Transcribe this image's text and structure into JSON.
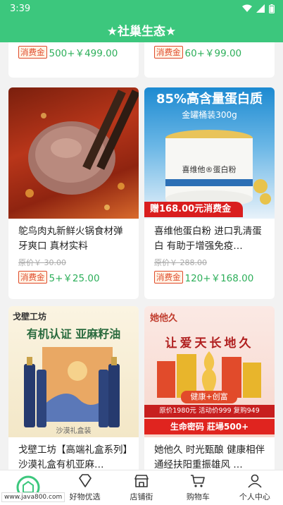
{
  "status": {
    "time": "3:39"
  },
  "header": {
    "title": "★社巢生态★"
  },
  "top_cards": [
    {
      "tag": "消费金",
      "price": "500+￥499.00"
    },
    {
      "tag": "消费金",
      "price": "60+￥99.00"
    }
  ],
  "products": [
    {
      "title": "鸵鸟肉丸新鲜火锅食材弹牙爽口 真材实料",
      "orig": "原价￥ 30.00",
      "tag": "消费金",
      "price": "5+￥25.00"
    },
    {
      "title": "喜维他蛋白粉 进口乳清蛋白 有助于增强免疫…",
      "orig": "原价￥ 288.00",
      "tag": "消费金",
      "price": "120+￥168.00",
      "banner_title": "85%高含量蛋白质",
      "banner_sub": "金罐桶装300g",
      "can_label": "喜维他®蛋白粉",
      "promo": "赠168.00元消费金"
    },
    {
      "title": "戈壁工坊【高端礼盒系列】沙漠礼盒有机亚麻…",
      "brand": "戈壁工坊",
      "banner": "有机认证 亚麻籽油",
      "box_label": "沙漠礼盒装"
    },
    {
      "title": "她他久 时光甄酿 健康相伴通经扶阳重振雄风 …",
      "brand": "她他久",
      "calligraphy": "让爱天长地久",
      "ribbon": "健康+创富",
      "deal": "原价1980元 活动价999 复购949",
      "life": "生命密码  莊埽500+"
    }
  ],
  "tabbar": {
    "items": [
      {
        "label": ""
      },
      {
        "label": "好物优选"
      },
      {
        "label": "店铺街"
      },
      {
        "label": "购物车"
      },
      {
        "label": "个人中心"
      }
    ]
  },
  "watermark": "www.java800.com"
}
